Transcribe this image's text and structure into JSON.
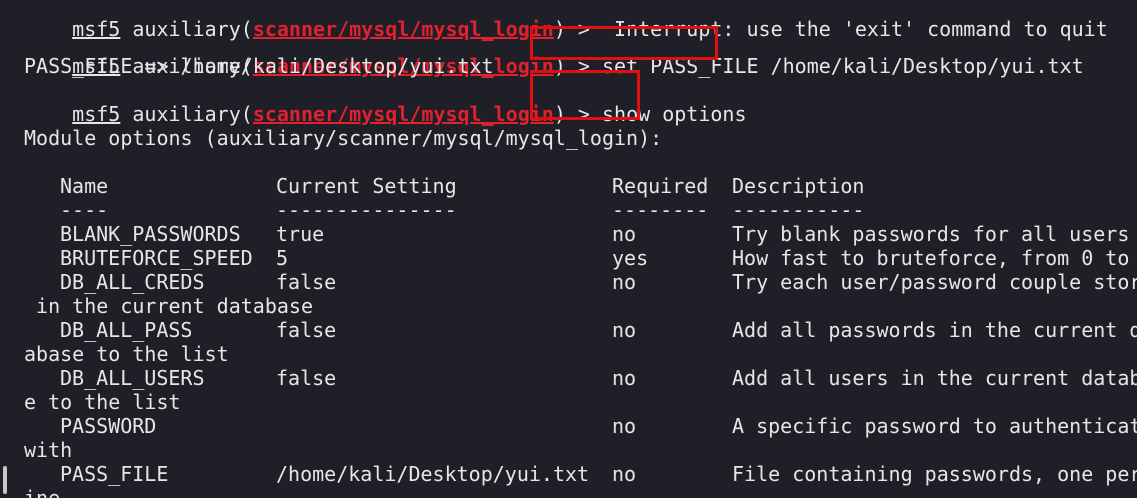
{
  "prompt": {
    "prefix": "msf5",
    "module_word": "auxiliary(",
    "module_path": "scanner/mysql/mysql_login",
    "module_close": ") >"
  },
  "lines": {
    "l0_cmd": "  Interrupt: use the 'exit' command to quit",
    "l1_cmd": " set PASS_FILE /home/kali/Desktop/yui.txt",
    "l2_output": "PASS_FILE => /home/kali/Desktop/yui.txt",
    "l3_cmd": " show options",
    "l5_module_options": "Module options (auxiliary/scanner/mysql/mysql_login):"
  },
  "table": {
    "headers": [
      "Name",
      "Current Setting",
      "Required",
      "Description"
    ],
    "dashes": [
      "----",
      "---------------",
      "--------",
      "-----------"
    ],
    "rows": [
      {
        "name": "BLANK_PASSWORDS",
        "setting": "true",
        "required": "no",
        "description": "Try blank passwords for all users",
        "wrap": ""
      },
      {
        "name": "BRUTEFORCE_SPEED",
        "setting": "5",
        "required": "yes",
        "description": "How fast to bruteforce, from 0 to",
        "wrap": ""
      },
      {
        "name": "DB_ALL_CREDS",
        "setting": "false",
        "required": "no",
        "description": "Try each user/password couple stor",
        "wrap": " in the current database"
      },
      {
        "name": "DB_ALL_PASS",
        "setting": "false",
        "required": "no",
        "description": "Add all passwords in the current d",
        "wrap": "abase to the list"
      },
      {
        "name": "DB_ALL_USERS",
        "setting": "false",
        "required": "no",
        "description": "Add all users in the current datab",
        "wrap": "e to the list"
      },
      {
        "name": "PASSWORD",
        "setting": "",
        "required": "no",
        "description": "A specific password to authenticat",
        "wrap": "with"
      },
      {
        "name": "PASS_FILE",
        "setting": "/home/kali/Desktop/yui.txt",
        "required": "no",
        "description": "File containing passwords, one per",
        "wrap": "ine"
      }
    ]
  },
  "colors": {
    "background": "#1f1f27",
    "text": "#e6e6e6",
    "module_path": "#e1212f",
    "highlight_box": "#e01010"
  }
}
